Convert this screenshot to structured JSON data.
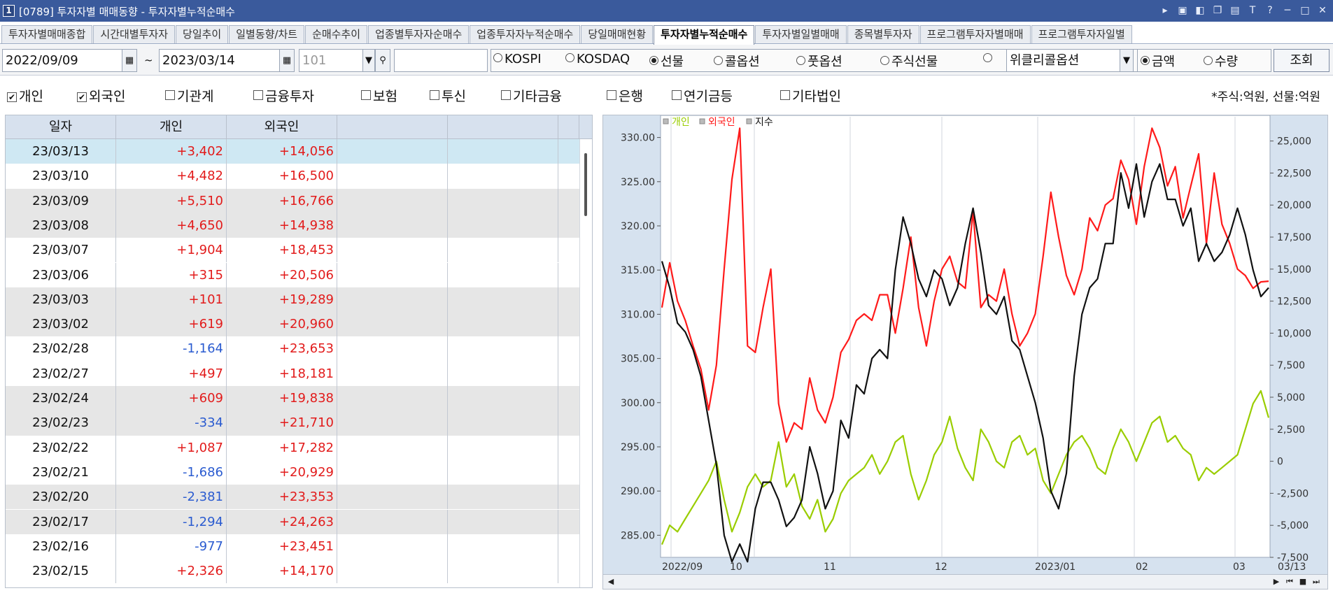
{
  "window": {
    "icon": "1",
    "title": "[0789] 투자자별 매매동향 - 투자자별누적순매수"
  },
  "tabs": [
    {
      "label": "투자자별매매종합",
      "active": false
    },
    {
      "label": "시간대별투자자",
      "active": false
    },
    {
      "label": "당일추이",
      "active": false
    },
    {
      "label": "일별동향/차트",
      "active": false
    },
    {
      "label": "순매수추이",
      "active": false
    },
    {
      "label": "업종별투자자순매수",
      "active": false
    },
    {
      "label": "업종투자자누적순매수",
      "active": false
    },
    {
      "label": "당일매매현황",
      "active": false
    },
    {
      "label": "투자자별누적순매수",
      "active": true
    },
    {
      "label": "투자자별일별매매",
      "active": false
    },
    {
      "label": "종목별투자자",
      "active": false
    },
    {
      "label": "프로그램투자자별매매",
      "active": false
    },
    {
      "label": "프로그램투자자일별",
      "active": false
    }
  ],
  "controls": {
    "start_date": "2022/09/09",
    "tilde": "~",
    "end_date": "2023/03/14",
    "code": "101",
    "search_value": "",
    "market_options": [
      {
        "label": "KOSPI",
        "selected": false
      },
      {
        "label": "KOSDAQ",
        "selected": false
      },
      {
        "label": "선물",
        "selected": true
      },
      {
        "label": "콜옵션",
        "selected": false
      },
      {
        "label": "풋옵션",
        "selected": false
      },
      {
        "label": "주식선물",
        "selected": false
      },
      {
        "label": "",
        "selected": false
      }
    ],
    "weekly_select": "위클리콜옵션",
    "unit_options": [
      {
        "label": "금액",
        "selected": true
      },
      {
        "label": "수량",
        "selected": false
      }
    ],
    "query_button": "조회"
  },
  "filters": [
    {
      "label": "개인",
      "checked": true
    },
    {
      "label": "외국인",
      "checked": true
    },
    {
      "label": "기관계",
      "checked": false
    },
    {
      "label": "금융투자",
      "checked": false
    },
    {
      "label": "보험",
      "checked": false
    },
    {
      "label": "투신",
      "checked": false
    },
    {
      "label": "기타금융",
      "checked": false
    },
    {
      "label": "은행",
      "checked": false
    },
    {
      "label": "연기금등",
      "checked": false
    },
    {
      "label": "기타법인",
      "checked": false
    }
  ],
  "unit_note": "*주식:억원, 선물:억원",
  "table": {
    "columns": [
      "일자",
      "개인",
      "외국인",
      "",
      "",
      ""
    ],
    "rows": [
      {
        "date": "23/03/13",
        "individual": "+3,402",
        "foreign": "+14,056",
        "selected": true
      },
      {
        "date": "23/03/10",
        "individual": "+4,482",
        "foreign": "+16,500"
      },
      {
        "date": "23/03/09",
        "individual": "+5,510",
        "foreign": "+16,766"
      },
      {
        "date": "23/03/08",
        "individual": "+4,650",
        "foreign": "+14,938"
      },
      {
        "date": "23/03/07",
        "individual": "+1,904",
        "foreign": "+18,453"
      },
      {
        "date": "23/03/06",
        "individual": "+315",
        "foreign": "+20,506"
      },
      {
        "date": "23/03/03",
        "individual": "+101",
        "foreign": "+19,289"
      },
      {
        "date": "23/03/02",
        "individual": "+619",
        "foreign": "+20,960"
      },
      {
        "date": "23/02/28",
        "individual": "-1,164",
        "foreign": "+23,653"
      },
      {
        "date": "23/02/27",
        "individual": "+497",
        "foreign": "+18,181"
      },
      {
        "date": "23/02/24",
        "individual": "+609",
        "foreign": "+19,838"
      },
      {
        "date": "23/02/23",
        "individual": "-334",
        "foreign": "+21,710"
      },
      {
        "date": "23/02/22",
        "individual": "+1,087",
        "foreign": "+17,282"
      },
      {
        "date": "23/02/21",
        "individual": "-1,686",
        "foreign": "+20,929"
      },
      {
        "date": "23/02/20",
        "individual": "-2,381",
        "foreign": "+23,353"
      },
      {
        "date": "23/02/17",
        "individual": "-1,294",
        "foreign": "+24,263"
      },
      {
        "date": "23/02/16",
        "individual": "-977",
        "foreign": "+23,451"
      },
      {
        "date": "23/02/15",
        "individual": "+2,326",
        "foreign": "+14,170"
      }
    ]
  },
  "colors": {
    "individual": "#9acd00",
    "foreign": "#ff1a1a",
    "index": "#111111",
    "positive": "#e21b1b",
    "negative": "#2a5bd0",
    "selected_row": "#cfe8f3",
    "shaded_row": "#e6e6e6"
  },
  "chart_data": {
    "type": "line",
    "legend": [
      "개인",
      "외국인",
      "지수"
    ],
    "legend_position": "top-left",
    "x_tick_labels": [
      "2022/09",
      "10",
      "11",
      "12",
      "2023/01",
      "02",
      "03",
      "03/13"
    ],
    "left_axis": {
      "ticks": [
        "330.00",
        "325.00",
        "320.00",
        "315.00",
        "310.00",
        "305.00",
        "300.00",
        "295.00",
        "290.00",
        "285.00"
      ],
      "range": [
        282.5,
        332.5
      ]
    },
    "right_axis": {
      "ticks": [
        "25,000",
        "22,500",
        "20,000",
        "17,500",
        "15,000",
        "12,500",
        "10,000",
        "7,500",
        "5,000",
        "2,500",
        "0",
        "-2,500",
        "-5,000",
        "-7,500"
      ],
      "range": [
        -7500,
        27000
      ]
    },
    "grid": "vertical",
    "series": [
      {
        "name": "지수",
        "axis": "left",
        "values": [
          316,
          313,
          309,
          308,
          306,
          303,
          298,
          293,
          285,
          282,
          284,
          282,
          288,
          291,
          291,
          289,
          286,
          287,
          289,
          295,
          292,
          288,
          290,
          298,
          296,
          302,
          301,
          305,
          306,
          305,
          315,
          321,
          318,
          314,
          312,
          315,
          314,
          311,
          313,
          318,
          322,
          317,
          311,
          310,
          312,
          307,
          306,
          303,
          300,
          296,
          290,
          288,
          292,
          303,
          310,
          313,
          314,
          318,
          318,
          326,
          322,
          327,
          321,
          325,
          327,
          323,
          323,
          320,
          322,
          316,
          318,
          316,
          317,
          319,
          322,
          319,
          315,
          312,
          313
        ]
      },
      {
        "name": "외국인",
        "axis": "right",
        "values": [
          12000,
          15500,
          12500,
          11000,
          9000,
          7200,
          4000,
          7500,
          15000,
          22000,
          26000,
          9000,
          8500,
          12000,
          15000,
          4500,
          1500,
          3000,
          2500,
          6500,
          4000,
          3000,
          5000,
          8500,
          9500,
          11000,
          11500,
          11000,
          13000,
          13000,
          10000,
          13500,
          17500,
          12000,
          9000,
          12500,
          15000,
          16000,
          14000,
          13500,
          19500,
          12000,
          13000,
          12500,
          15000,
          11500,
          9000,
          10000,
          11500,
          16000,
          21000,
          17500,
          14500,
          13000,
          15000,
          19000,
          18000,
          20000,
          20500,
          23500,
          22000,
          18500,
          23000,
          26000,
          24500,
          21500,
          23000,
          19000,
          21500,
          24000,
          17000,
          22500,
          18500,
          17000,
          15000,
          14500,
          13500,
          14000,
          14056
        ]
      },
      {
        "name": "개인",
        "axis": "right",
        "values": [
          -6500,
          -5000,
          -5500,
          -4500,
          -3500,
          -2500,
          -1500,
          0,
          -3000,
          -5500,
          -4000,
          -2000,
          -1000,
          -2000,
          -1500,
          1500,
          -2000,
          -1000,
          -3500,
          -4500,
          -3000,
          -5500,
          -4500,
          -2500,
          -1500,
          -1000,
          -500,
          500,
          -1000,
          0,
          1500,
          2000,
          -1000,
          -3000,
          -1500,
          500,
          1500,
          3500,
          1000,
          -500,
          -1500,
          2500,
          1500,
          0,
          -500,
          1500,
          2000,
          500,
          1000,
          -1500,
          -2500,
          -1000,
          500,
          1500,
          2000,
          1000,
          -500,
          -1000,
          1000,
          2500,
          1500,
          0,
          1500,
          3000,
          3500,
          1500,
          2000,
          1000,
          500,
          -1500,
          -500,
          -1000,
          -500,
          0,
          500,
          2500,
          4500,
          5500,
          3402
        ]
      }
    ]
  }
}
